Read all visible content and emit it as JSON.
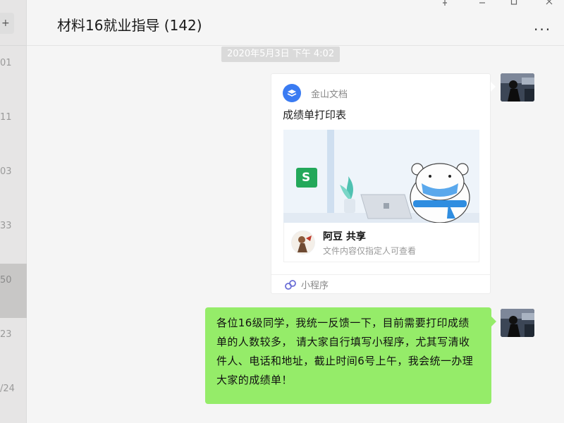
{
  "sidebar": {
    "add_label": "+",
    "items": [
      {
        "time": "01"
      },
      {
        "time": "11"
      },
      {
        "time": "03"
      },
      {
        "time": "33"
      },
      {
        "time": "50"
      },
      {
        "time": "23"
      },
      {
        "time": "/24"
      }
    ]
  },
  "window": {
    "pin_icon": "pin-icon",
    "minimize_icon": "minimize-icon",
    "maximize_icon": "maximize-icon",
    "close_icon": "close-icon"
  },
  "chat": {
    "title": "材料16就业指导 (142)",
    "more_label": "...",
    "timestamp": "2020年5月3日 下午 4:02",
    "card": {
      "app_name": "金山文档",
      "title": "成绩单打印表",
      "share_name": "阿豆 共享",
      "share_desc": "文件内容仅指定人可查看",
      "footer_label": "小程序",
      "doc_badge": "S"
    },
    "message": "各位16级同学，我统一反馈一下，目前需要打印成绩单的人数较多， 请大家自行填写小程序，尤其写清收件人、电话和地址，截止时间6号上午，我会统一办理大家的成绩单！"
  },
  "colors": {
    "bubble_green": "#95ec69",
    "app_blue": "#3a7bf2",
    "doc_green": "#23a85a"
  }
}
